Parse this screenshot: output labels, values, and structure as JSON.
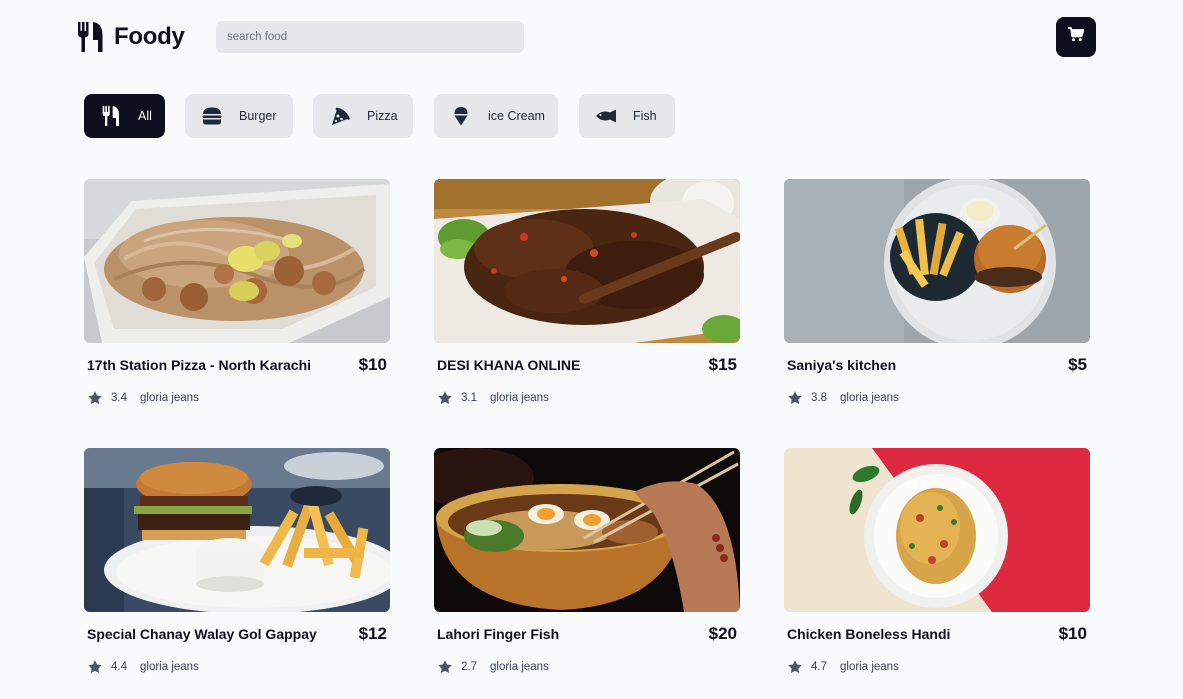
{
  "app": {
    "name": "Foody"
  },
  "search": {
    "placeholder": "search food",
    "value": ""
  },
  "categories": [
    {
      "label": "All",
      "icon": "utensils-icon",
      "active": true
    },
    {
      "label": "Burger",
      "icon": "burger-icon",
      "active": false
    },
    {
      "label": "Pizza",
      "icon": "pizza-icon",
      "active": false
    },
    {
      "label": "ice Cream",
      "icon": "ice-cream-icon",
      "active": false
    },
    {
      "label": "Fish",
      "icon": "fish-icon",
      "active": false
    }
  ],
  "products": [
    {
      "name": "17th Station Pizza - North Karachi",
      "price": "$10",
      "rating": "3.4",
      "vendor": "gloria jeans",
      "image": "noodles-photo"
    },
    {
      "name": "DESI KHANA ONLINE",
      "price": "$15",
      "rating": "3.1",
      "vendor": "gloria jeans",
      "image": "grilled-meat-photo"
    },
    {
      "name": "Saniya's kitchen",
      "price": "$5",
      "rating": "3.8",
      "vendor": "gloria jeans",
      "image": "burger-fries-plate-photo"
    },
    {
      "name": "Special Chanay Walay Gol Gappay",
      "price": "$12",
      "rating": "4.4",
      "vendor": "gloria jeans",
      "image": "burger-fries-photo"
    },
    {
      "name": "Lahori Finger Fish",
      "price": "$20",
      "rating": "2.7",
      "vendor": "gloria jeans",
      "image": "ramen-bowl-photo"
    },
    {
      "name": "Chicken Boneless Handi",
      "price": "$10",
      "rating": "4.7",
      "vendor": "gloria jeans",
      "image": "pasta-plate-photo"
    }
  ],
  "colors": {
    "dark": "#0d0e1e",
    "chip": "#e5e7eb",
    "background": "#f8fafc",
    "star": "#4b5563"
  }
}
